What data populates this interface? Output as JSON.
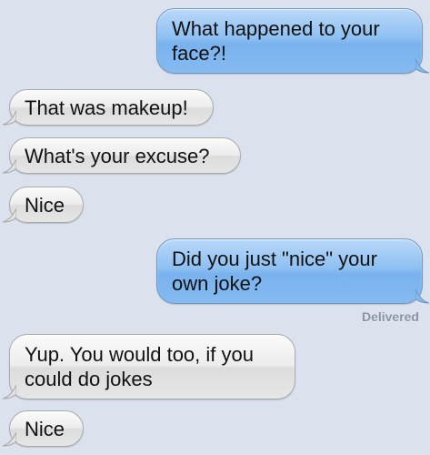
{
  "messages": [
    {
      "direction": "outgoing",
      "lines": [
        "What happened to your",
        "face?!"
      ]
    },
    {
      "direction": "incoming",
      "lines": [
        "That was makeup!"
      ]
    },
    {
      "direction": "incoming",
      "lines": [
        "What's your excuse?"
      ]
    },
    {
      "direction": "incoming",
      "lines": [
        "Nice"
      ]
    },
    {
      "direction": "outgoing",
      "lines": [
        "Did you just \"nice\" your",
        "own joke?"
      ]
    },
    {
      "direction": "incoming",
      "lines": [
        "Yup. You would too, if you",
        "could do jokes"
      ]
    },
    {
      "direction": "incoming",
      "lines": [
        "Nice"
      ]
    }
  ],
  "delivery_status": "Delivered",
  "colors": {
    "background": "#dbe2ed",
    "outgoing_bubble": "#8ec0f2",
    "incoming_bubble": "#e6e6e6",
    "status_text": "#8a93a3"
  }
}
